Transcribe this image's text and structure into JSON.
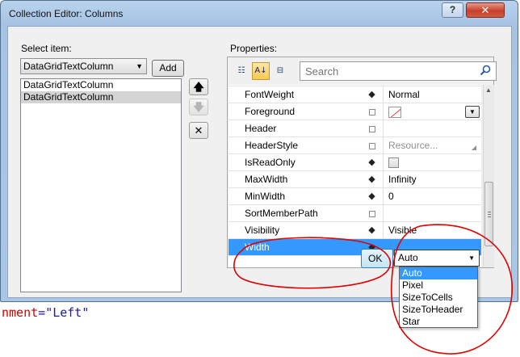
{
  "window": {
    "title": "Collection Editor: Columns",
    "help_label": "?",
    "close_label": "✕"
  },
  "left": {
    "select_label": "Select item:",
    "type_combo": "DataGridTextColumn",
    "add_label": "Add",
    "items": [
      {
        "label": "DataGridTextColumn",
        "selected": false
      },
      {
        "label": "DataGridTextColumn",
        "selected": true
      }
    ]
  },
  "properties": {
    "label": "Properties:",
    "search_placeholder": "Search",
    "rows": [
      {
        "name": "FontWeight",
        "marker": "filled",
        "value": "Normal",
        "kind": "text"
      },
      {
        "name": "Foreground",
        "marker": "empty",
        "value": "",
        "kind": "brush"
      },
      {
        "name": "Header",
        "marker": "empty",
        "value": "",
        "kind": "text"
      },
      {
        "name": "HeaderStyle",
        "marker": "empty",
        "value": "Resource...",
        "kind": "resource"
      },
      {
        "name": "IsReadOnly",
        "marker": "filled",
        "value": "",
        "kind": "checkbox"
      },
      {
        "name": "MaxWidth",
        "marker": "filled",
        "value": "Infinity",
        "kind": "text"
      },
      {
        "name": "MinWidth",
        "marker": "filled",
        "value": "0",
        "kind": "text"
      },
      {
        "name": "SortMemberPath",
        "marker": "empty",
        "value": "",
        "kind": "text"
      },
      {
        "name": "Visibility",
        "marker": "filled",
        "value": "Visible",
        "kind": "text"
      },
      {
        "name": "Width",
        "marker": "filled",
        "value": "",
        "kind": "combo",
        "selected": true
      }
    ]
  },
  "width_combo": {
    "value": "Auto",
    "options": [
      "Auto",
      "Pixel",
      "SizeToCells",
      "SizeToHeader",
      "Star"
    ],
    "selected_option": "Auto"
  },
  "ok_label": "OK",
  "background_code": {
    "line1_attr": "nment",
    "line1_eq": "=",
    "line1_val": "\"Left\""
  },
  "colors": {
    "selection": "#3399ff",
    "annotation": "#e00000"
  }
}
